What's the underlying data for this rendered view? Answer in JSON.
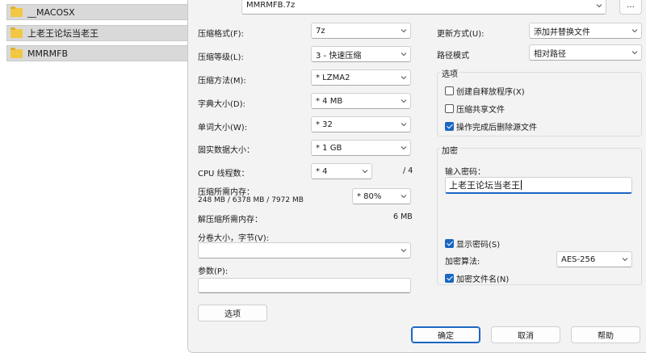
{
  "explorer": {
    "folders": [
      {
        "name": "__MACOSX"
      },
      {
        "name": "上老王论坛当老王"
      },
      {
        "name": "MMRMFB"
      }
    ]
  },
  "dialog": {
    "archive": {
      "value": "MMRMFB.7z",
      "browse_label": "..."
    },
    "left": {
      "format": {
        "label": "压缩格式(F):",
        "value": "7z"
      },
      "level": {
        "label": "压缩等级(L):",
        "value": "3 - 快速压缩"
      },
      "method": {
        "label": "压缩方法(M):",
        "value": "* LZMA2"
      },
      "dict_size": {
        "label": "字典大小(D):",
        "value": "* 4 MB"
      },
      "word_size": {
        "label": "单词大小(W):",
        "value": "* 32"
      },
      "solid_size": {
        "label": "固实数据大小：",
        "value": "* 1 GB"
      },
      "threads": {
        "label": "CPU 线程数：",
        "value": "* 4",
        "total": "/ 4"
      },
      "memory": {
        "label": "压缩所需内存：",
        "detail": "248 MB / 6378 MB / 7972 MB",
        "percent": "* 80%"
      },
      "decompress_memory": {
        "label": "解压缩所需内存：",
        "value": "6 MB"
      },
      "split": {
        "label": "分卷大小，字节(V):",
        "value": ""
      },
      "params": {
        "label": "参数(P):",
        "value": ""
      },
      "options_button": "选项"
    },
    "right": {
      "update_mode": {
        "label": "更新方式(U):",
        "value": "添加并替换文件"
      },
      "path_mode": {
        "label": "路径模式",
        "value": "相对路径"
      },
      "options_group": {
        "title": "选项",
        "sfx": {
          "label": "创建自释放程序(X)",
          "checked": false
        },
        "shared": {
          "label": "压缩共享文件",
          "checked": false
        },
        "delete_after": {
          "label": "操作完成后删除源文件",
          "checked": true
        }
      },
      "encryption_group": {
        "title": "加密",
        "password_label": "输入密码：",
        "password_value": "上老王论坛当老王",
        "show_password": {
          "label": "显示密码(S)",
          "checked": true
        },
        "method_label": "加密算法:",
        "method_value": "AES-256",
        "encrypt_names": {
          "label": "加密文件名(N)",
          "checked": true
        }
      }
    },
    "buttons": {
      "ok": "确定",
      "cancel": "取消",
      "help": "帮助"
    }
  }
}
